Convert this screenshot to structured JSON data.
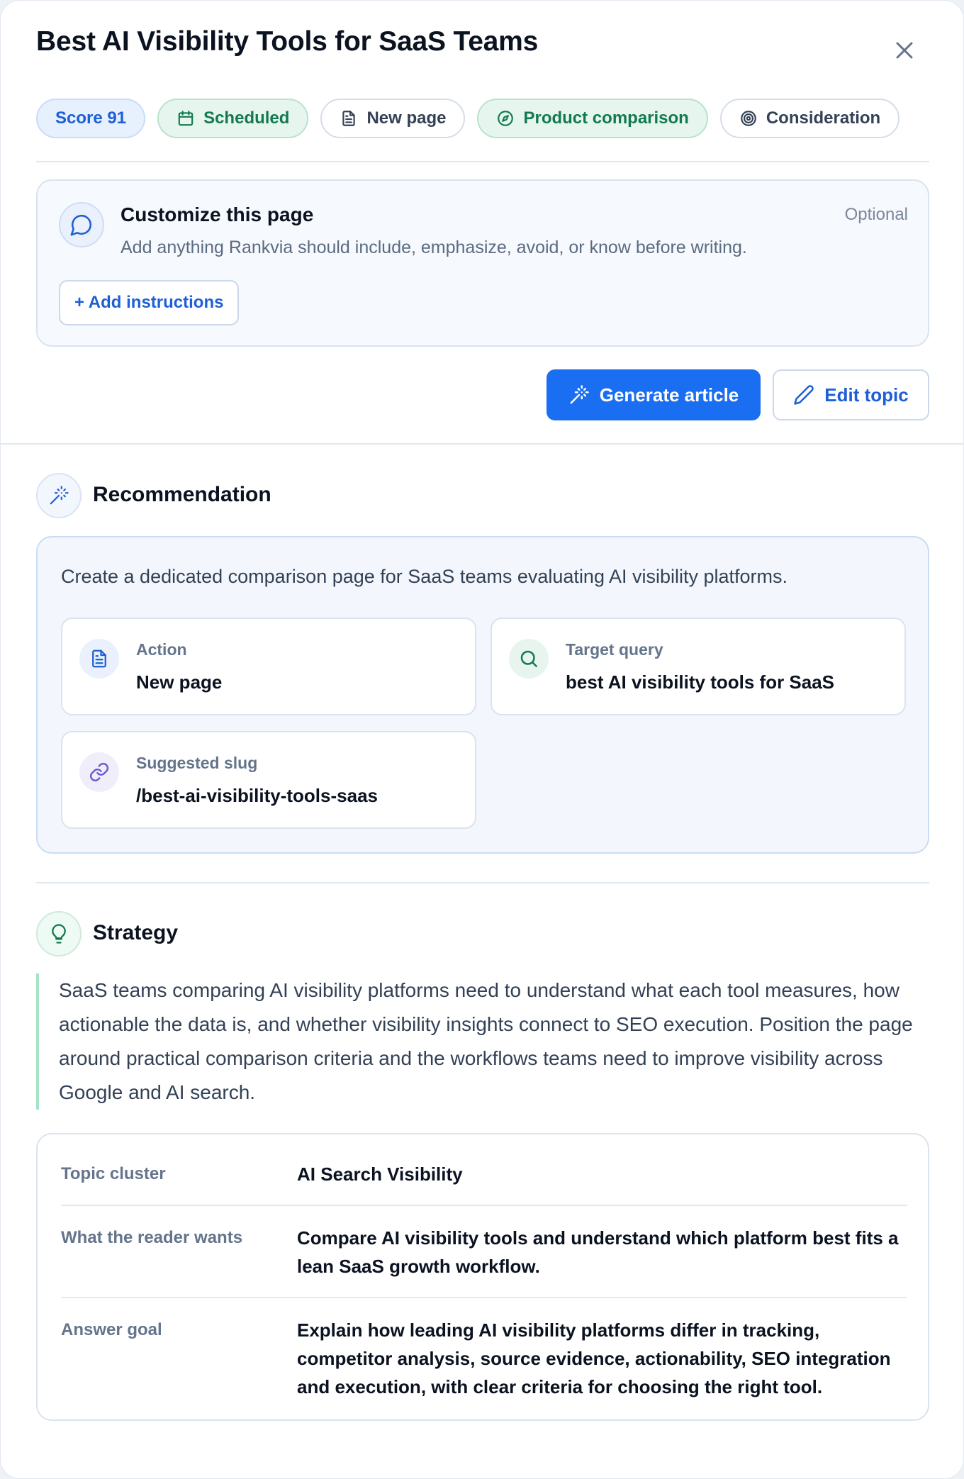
{
  "header": {
    "title": "Best AI Visibility Tools for SaaS Teams"
  },
  "chips": [
    {
      "label": "Score 91",
      "icon": null
    },
    {
      "label": "Scheduled",
      "icon": "calendar-icon"
    },
    {
      "label": "New page",
      "icon": "document-icon"
    },
    {
      "label": "Product comparison",
      "icon": "compass-icon"
    },
    {
      "label": "Consideration",
      "icon": "target-icon"
    }
  ],
  "customize": {
    "title": "Customize this page",
    "description": "Add anything Rankvia should include, emphasize, avoid, or know before writing.",
    "optional_label": "Optional",
    "add_button": "+ Add instructions"
  },
  "actions": {
    "generate": "Generate article",
    "edit": "Edit topic"
  },
  "recommendation": {
    "heading": "Recommendation",
    "summary": "Create a dedicated comparison page for SaaS teams evaluating AI visibility platforms.",
    "action": {
      "label": "Action",
      "value": "New page"
    },
    "target_query": {
      "label": "Target query",
      "value": "best AI visibility tools for SaaS"
    },
    "slug": {
      "label": "Suggested slug",
      "value": "/best-ai-visibility-tools-saas"
    }
  },
  "strategy": {
    "heading": "Strategy",
    "text": "SaaS teams comparing AI visibility platforms need to understand what each tool measures, how actionable the data is, and whether visibility insights connect to SEO execution. Position the page around practical comparison criteria and the workflows teams need to improve visibility across Google and AI search.",
    "facts": [
      {
        "key": "Topic cluster",
        "value": "AI Search Visibility"
      },
      {
        "key": "What the reader wants",
        "value": "Compare AI visibility tools and understand which platform best fits a lean SaaS growth workflow."
      },
      {
        "key": "Answer goal",
        "value": "Explain how leading AI visibility platforms differ in tracking, competitor analysis, source evidence, actionability, SEO integration and execution, with clear criteria for choosing the right tool."
      }
    ]
  },
  "colors": {
    "accent": "#1a6ef2",
    "success": "#137a4f",
    "text": "#0b1220",
    "muted": "#64748b"
  }
}
